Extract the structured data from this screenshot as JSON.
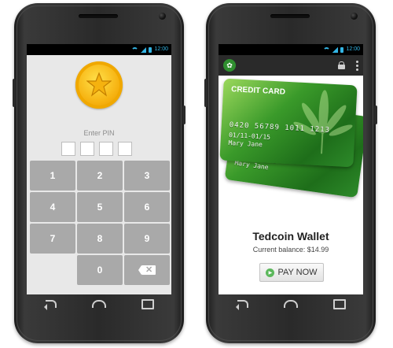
{
  "status": {
    "time": "12:00"
  },
  "pin_screen": {
    "label": "Enter PIN",
    "keys": [
      "1",
      "2",
      "3",
      "4",
      "5",
      "6",
      "7",
      "8",
      "9",
      "0"
    ]
  },
  "wallet_screen": {
    "card": {
      "title": "CREDIT CARD",
      "number": "0420 56789 1011 1213",
      "expiry": "01/11-01/15",
      "holder": "Mary Jane"
    },
    "title": "Tedcoin Wallet",
    "balance": "Current balance: $14.99",
    "pay_label": "PAY NOW"
  },
  "colors": {
    "accent_blue": "#33b5e5",
    "key_gray": "#a9a9a9",
    "card_green": "#2d8a2a",
    "pay_green": "#5cb85c"
  }
}
